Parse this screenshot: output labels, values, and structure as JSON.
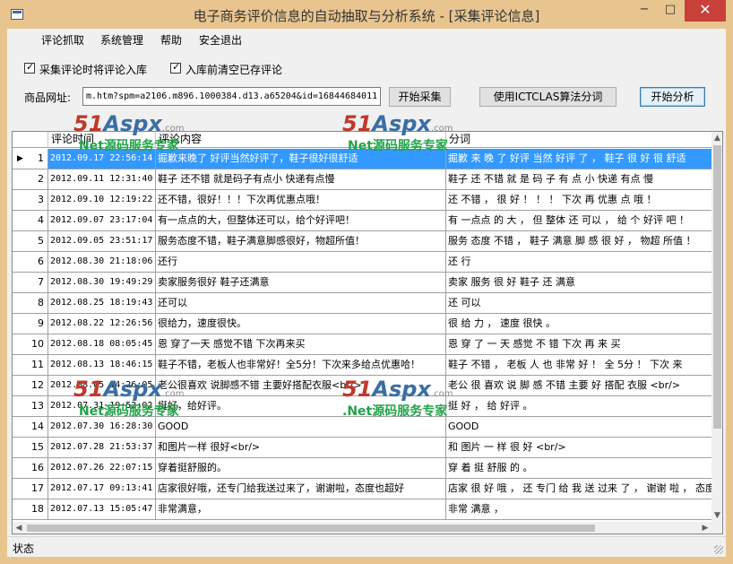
{
  "window": {
    "title": "电子商务评价信息的自动抽取与分析系统 - [采集评论信息]",
    "minimize": "−",
    "maximize": "□",
    "close": "✕"
  },
  "menu": [
    "评论抓取",
    "系统管理",
    "帮助",
    "安全退出"
  ],
  "options": {
    "store_on_collect": {
      "label": "采集评论时将评论入库",
      "checked": true
    },
    "clear_before_store": {
      "label": "入库前清空已存评论",
      "checked": true
    }
  },
  "url": {
    "label": "商品网址:",
    "value": "m.htm?spm=a2106.m896.1000384.d13.a65204&id=16844684011"
  },
  "buttons": {
    "start_collect": "开始采集",
    "segment": "使用ICTCLAS算法分词",
    "start_analysis": "开始分析"
  },
  "grid": {
    "columns": [
      "评论时间",
      "评论内容",
      "分词"
    ],
    "rows": [
      {
        "n": "1",
        "time": "2012.09.17 22:56:14",
        "content": "掘歉来晚了  好评当然好评了，鞋子很好很舒适",
        "seg": "掘歉 来 晚 了 好评 当然 好评 了 ， 鞋子 很 好 很 舒适",
        "selected": true
      },
      {
        "n": "2",
        "time": "2012.09.11 12:31:40",
        "content": "鞋子  还不错     就是码子有点小      快递有点慢",
        "seg": "鞋子 还 不错 就 是 码 子 有 点 小 快递 有点 慢"
      },
      {
        "n": "3",
        "time": "2012.09.10 12:19:22",
        "content": "还不错，很好！！！下次再优惠点哦！",
        "seg": "还 不错 ， 很 好 ！ ！ ！ 下次 再 优惠 点 哦 ！"
      },
      {
        "n": "4",
        "time": "2012.09.07 23:17:04",
        "content": "有一点点的大，但整体还可以，给个好评吧！",
        "seg": "有 一点点 的 大 ， 但 整体 还 可以 ， 给 个 好评 吧 ！"
      },
      {
        "n": "5",
        "time": "2012.09.05 23:51:17",
        "content": "服务态度不错，鞋子满意脚感很好，物超所值！",
        "seg": "服务 态度 不错 ， 鞋子 满意 脚 感 很 好 ， 物超 所值 ！"
      },
      {
        "n": "6",
        "time": "2012.08.30 21:18:06",
        "content": "还行",
        "seg": "还 行"
      },
      {
        "n": "7",
        "time": "2012.08.30 19:49:29",
        "content": "卖家服务很好 鞋子还满意",
        "seg": "卖家 服务 很 好 鞋子 还 满意"
      },
      {
        "n": "8",
        "time": "2012.08.25 18:19:43",
        "content": "还可以",
        "seg": "还 可以"
      },
      {
        "n": "9",
        "time": "2012.08.22 12:26:56",
        "content": "很给力，速度很快。",
        "seg": "很 给 力 ， 速度 很快 。"
      },
      {
        "n": "10",
        "time": "2012.08.18 08:05:45",
        "content": "恩 穿了一天    感觉不错    下次再来买",
        "seg": "恩 穿 了 一 天 感觉 不 错 下次 再 来 买"
      },
      {
        "n": "11",
        "time": "2012.08.13 18:46:15",
        "content": "鞋子不错，老板人也非常好！全5分！下次来多给点优惠哈！",
        "seg": "鞋子 不错 ， 老板 人 也 非常 好 ！ 全 5分 ！ 下次 来"
      },
      {
        "n": "12",
        "time": "2012.08.05 14:26:05",
        "content": "老公很喜欢   说脚感不错   主要好搭配衣服<br/>",
        "seg": "老公 很 喜欢 说 脚 感 不错 主要 好 搭配 衣服 <br/>"
      },
      {
        "n": "13",
        "time": "2012.07.31 19:52:02",
        "content": "挺好，给好评。",
        "seg": "挺 好 ， 给 好评 。"
      },
      {
        "n": "14",
        "time": "2012.07.30 16:28:30",
        "content": "GOOD",
        "seg": "GOOD"
      },
      {
        "n": "15",
        "time": "2012.07.28 21:53:37",
        "content": "和图片一样   很好<br/>",
        "seg": "和 图片 一 样 很 好 <br/>"
      },
      {
        "n": "16",
        "time": "2012.07.26 22:07:15",
        "content": "穿着挺舒服的。",
        "seg": "穿 着 挺 舒服 的 。"
      },
      {
        "n": "17",
        "time": "2012.07.17 09:13:41",
        "content": "店家很好哦，还专门给我送过来了，谢谢啦，态度也超好",
        "seg": "店家 很 好 哦 ， 还 专门 给 我 送 过来 了 ， 谢谢 啦 ， 态度"
      },
      {
        "n": "18",
        "time": "2012.07.13 15:05:47",
        "content": "非常满意，",
        "seg": "非常 满意 ，"
      }
    ]
  },
  "status": "状态",
  "watermark": {
    "logo_a": "51",
    "logo_b": "Aspx",
    "logo_c": ".com",
    "sub_a": "Net源码服务专家",
    "sub_b": ".Net源码服务专家"
  }
}
